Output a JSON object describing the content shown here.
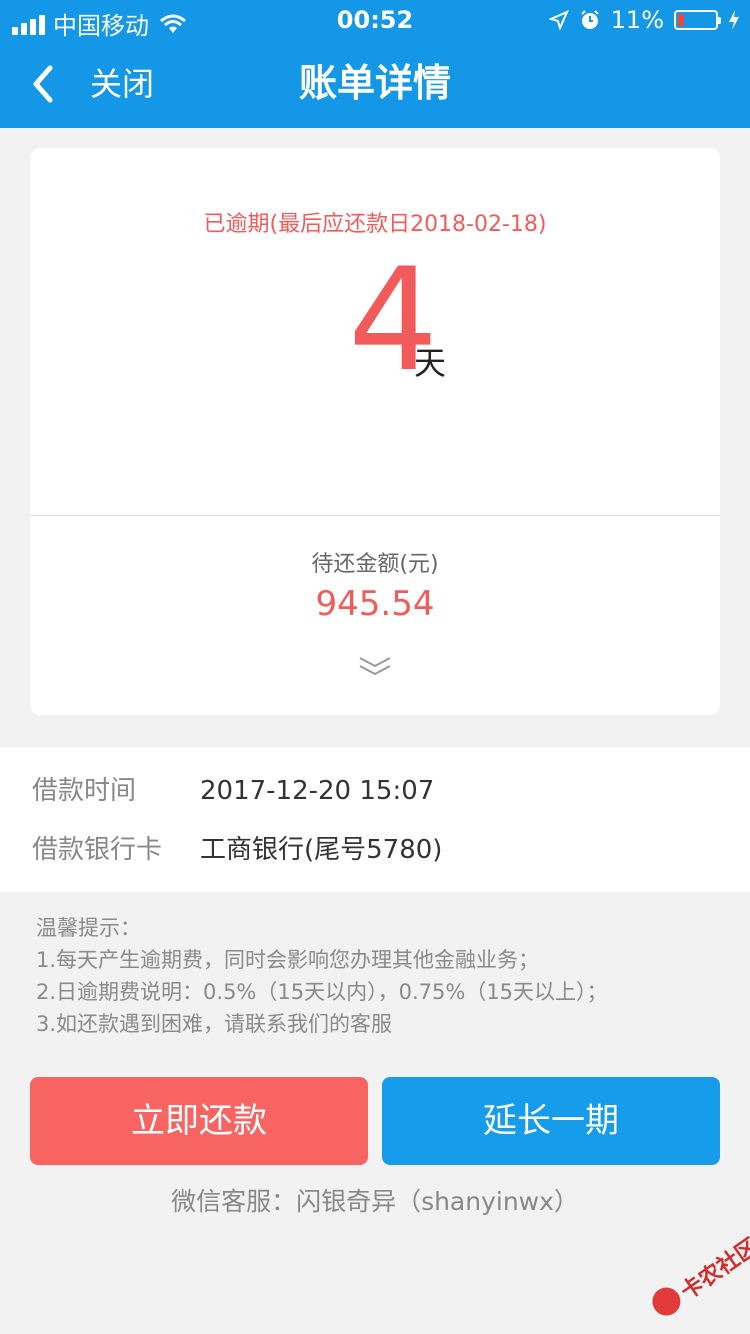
{
  "status_bar": {
    "carrier": "中国移动",
    "time": "00:52",
    "battery_percent": "11%",
    "battery_level": 0.11,
    "icons": [
      "signal-icon",
      "wifi-icon",
      "location-icon",
      "alarm-icon",
      "battery-icon",
      "charging-icon"
    ]
  },
  "nav": {
    "back_icon": "chevron-left-icon",
    "close_label": "关闭",
    "title": "账单详情"
  },
  "bill_card": {
    "overdue_note": "已逾期(最后应还款日2018-02-18)",
    "overdue_days": "4",
    "days_unit": "天",
    "amount_label": "待还金额(元)",
    "amount": "945.54",
    "expand_icon": "double-chevron-down-icon"
  },
  "info": {
    "rows": [
      {
        "label": "借款时间",
        "value": "2017-12-20 15:07"
      },
      {
        "label": "借款银行卡",
        "value": "工商银行(尾号5780)"
      }
    ]
  },
  "tips": {
    "title": "温馨提示：",
    "lines": [
      "1.每天产生逾期费，同时会影响您办理其他金融业务；",
      "2.日逾期费说明：0.5%（15天以内），0.75%（15天以上）；",
      "3.如还款遇到困难，请联系我们的客服"
    ]
  },
  "actions": {
    "repay_label": "立即还款",
    "extend_label": "延长一期"
  },
  "service_text": "微信客服：闪银奇异（shanyinwx）",
  "watermark_text": "卡农社区",
  "colors": {
    "brand_blue": "#1497e6",
    "alert_red": "#f25b5b",
    "repay_button": "#f76462",
    "extend_button": "#169ceb"
  }
}
